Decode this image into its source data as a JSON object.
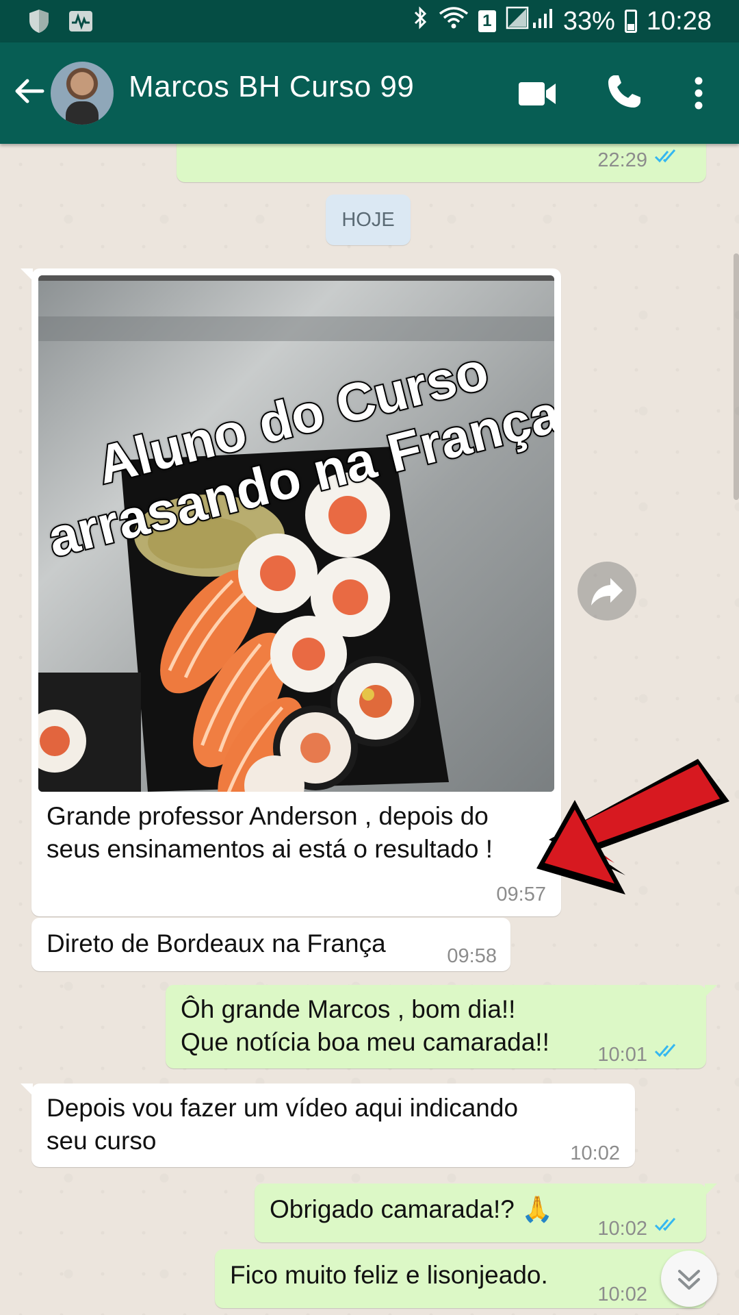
{
  "status_bar": {
    "battery_percent": "33%",
    "time": "10:28",
    "sim_slot": "1"
  },
  "header": {
    "contact_name": "Marcos BH Curso 99"
  },
  "chat": {
    "prev_message_time": "22:29",
    "date_divider": "HOJE",
    "image_message": {
      "overlay_line1": "Aluno do Curso",
      "overlay_line2": "arrasando na França",
      "caption": "Grande professor Anderson , depois do seus ensinamentos ai está o resultado !",
      "time": "09:57"
    },
    "messages": [
      {
        "direction": "in",
        "text": "Direto de Bordeaux na França",
        "time": "09:58"
      },
      {
        "direction": "out",
        "line1": "Ôh grande Marcos , bom dia!!",
        "line2": "Que notícia boa meu camarada!!",
        "time": "10:01"
      },
      {
        "direction": "in",
        "line1": "Depois vou fazer um vídeo aqui indicando",
        "line2": "seu curso",
        "time": "10:02"
      },
      {
        "direction": "out",
        "text": "Obrigado camarada!? 🙏",
        "time": "10:02"
      },
      {
        "direction": "out",
        "text": "Fico muito feliz e lisonjeado.",
        "time": "10:02"
      }
    ]
  },
  "colors": {
    "header": "#075e54",
    "status_bar": "#054d44",
    "outgoing_bubble": "#dcf8c6",
    "incoming_bubble": "#ffffff",
    "read_ticks": "#34b7f1",
    "annotation_arrow": "#d71920"
  },
  "icons": {
    "status_left": [
      "shield-icon",
      "activity-icon"
    ],
    "status_right": [
      "bluetooth-icon",
      "wifi-icon",
      "sim-icon",
      "signal-icon",
      "battery-icon"
    ],
    "header": [
      "back-arrow-icon",
      "video-call-icon",
      "phone-icon",
      "more-vert-icon"
    ],
    "chat": [
      "forward-icon",
      "double-check-icon",
      "chevron-double-down-icon"
    ]
  }
}
